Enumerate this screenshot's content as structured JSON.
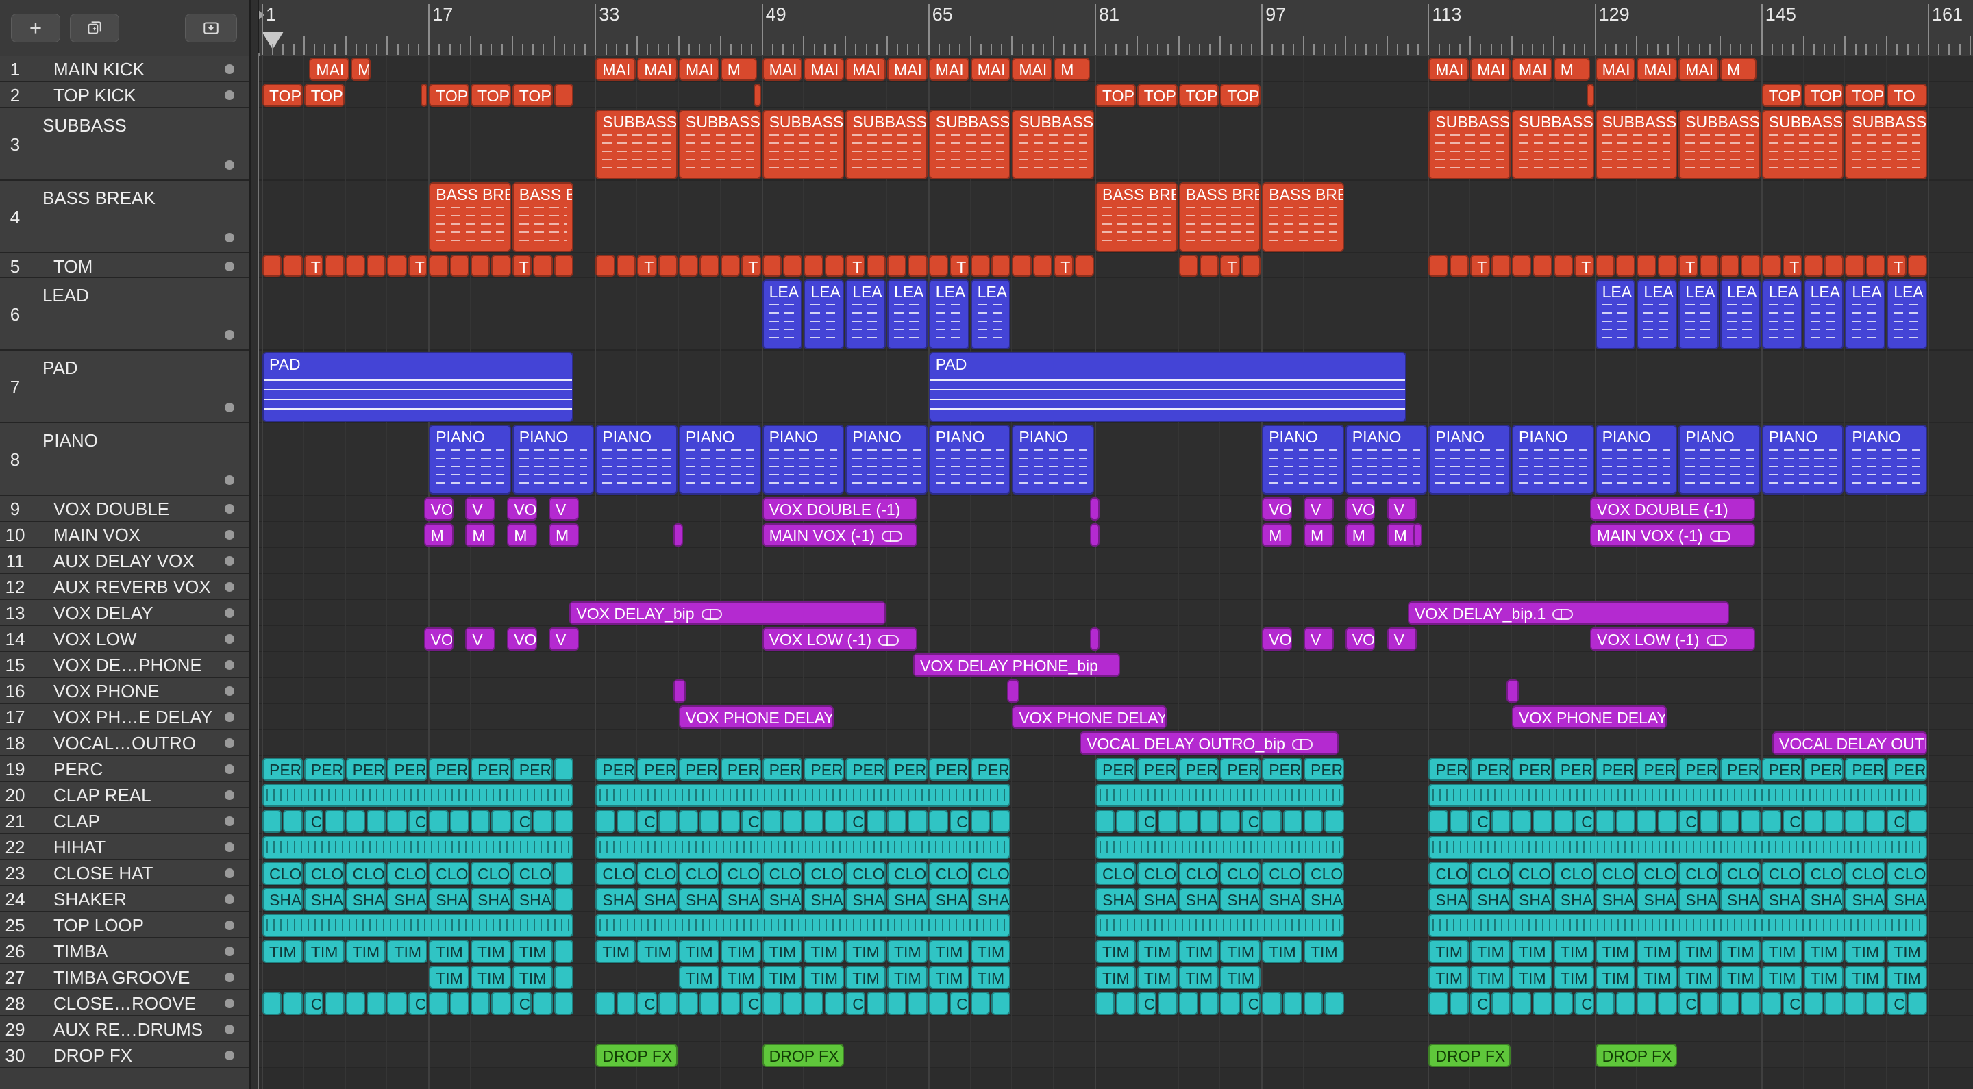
{
  "toolbar": {
    "buttons": [
      {
        "name": "add-track-button",
        "icon": "plus-icon"
      },
      {
        "name": "duplicate-track-button",
        "icon": "duplicate-icon"
      },
      {
        "name": "catch-button",
        "icon": "download-tray-icon"
      }
    ]
  },
  "ruler": {
    "bars": [
      "1",
      "17",
      "33",
      "49",
      "65",
      "81",
      "97",
      "113",
      "129",
      "145",
      "161"
    ]
  },
  "colors": {
    "red": "#d8492d",
    "blue": "#4444d6",
    "magenta": "#b42ad0",
    "teal": "#30c4c4",
    "green": "#5fc73b"
  },
  "tracks": [
    {
      "num": "1",
      "name": "MAIN KICK"
    },
    {
      "num": "2",
      "name": "TOP KICK"
    },
    {
      "num": "3",
      "name": "SUBBASS"
    },
    {
      "num": "4",
      "name": "BASS BREAK"
    },
    {
      "num": "5",
      "name": "TOM"
    },
    {
      "num": "6",
      "name": "LEAD"
    },
    {
      "num": "7",
      "name": "PAD"
    },
    {
      "num": "8",
      "name": "PIANO"
    },
    {
      "num": "9",
      "name": "VOX DOUBLE"
    },
    {
      "num": "10",
      "name": "MAIN VOX"
    },
    {
      "num": "11",
      "name": "AUX DELAY VOX"
    },
    {
      "num": "12",
      "name": "AUX REVERB VOX"
    },
    {
      "num": "13",
      "name": "VOX DELAY"
    },
    {
      "num": "14",
      "name": "VOX LOW"
    },
    {
      "num": "15",
      "name": "VOX DE…PHONE"
    },
    {
      "num": "16",
      "name": "VOX PHONE"
    },
    {
      "num": "17",
      "name": "VOX PH…E DELAY"
    },
    {
      "num": "18",
      "name": "VOCAL…OUTRO"
    },
    {
      "num": "19",
      "name": "PERC"
    },
    {
      "num": "20",
      "name": "CLAP REAL"
    },
    {
      "num": "21",
      "name": "CLAP"
    },
    {
      "num": "22",
      "name": "HIHAT"
    },
    {
      "num": "23",
      "name": "CLOSE HAT"
    },
    {
      "num": "24",
      "name": "SHAKER"
    },
    {
      "num": "25",
      "name": "TOP LOOP"
    },
    {
      "num": "26",
      "name": "TIMBA"
    },
    {
      "num": "27",
      "name": "TIMBA GROOVE"
    },
    {
      "num": "28",
      "name": "CLOSE…ROOVE"
    },
    {
      "num": "29",
      "name": "AUX RE…DRUMS"
    },
    {
      "num": "30",
      "name": "DROP FX"
    }
  ],
  "region_labels": {
    "main_kick": "MAI",
    "main_kick_short": "M",
    "top_kick": "TOP",
    "top_kick_short": "TO",
    "subbass": "SUBBASS",
    "bass_break": "BASS BRE",
    "bass_break_short": "BASS B",
    "tom": "T",
    "lead": "LEA",
    "pad": "PAD",
    "piano": "PIANO",
    "vox_double": "VOX DOUBLE (-1)",
    "vox_double_short": "VO",
    "vox_double_v": "V",
    "main_vox": "MAIN VOX (-1)",
    "main_vox_short": "M",
    "vox_delay": "VOX DELAY_bip",
    "vox_delay_2": "VOX DELAY_bip.1",
    "vox_low": "VOX LOW (-1)",
    "vox_low_short": "VO",
    "vox_low_v": "V",
    "vox_delay_phone": "VOX DELAY PHONE_bip",
    "vox_phone_delay": "VOX PHONE DELAY",
    "vocal_delay_outro": "VOCAL DELAY OUTRO_bip",
    "vocal_delay_outro_2": "VOCAL DELAY OUTRO_",
    "perc": "PER",
    "clap": "C",
    "close_hat": "CLO",
    "shaker": "SHA",
    "timba": "TIM",
    "drop_fx": "DROP FX"
  }
}
